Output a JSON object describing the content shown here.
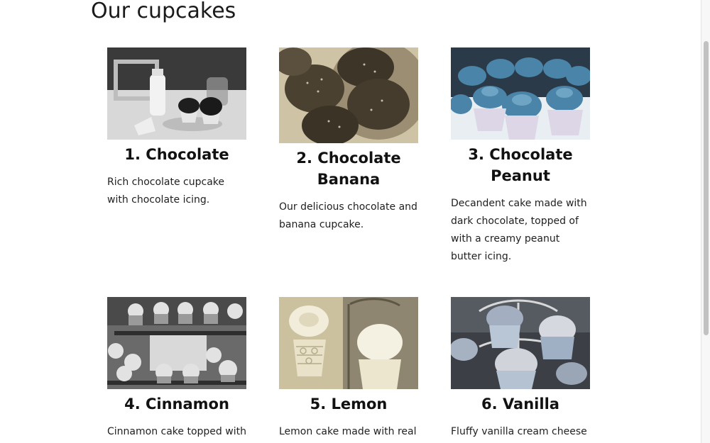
{
  "page": {
    "title": "Our cupcakes"
  },
  "cupcakes": [
    {
      "name": "1. Chocolate",
      "description": "Rich chocolate cupcake with chocolate icing.",
      "image_icon": "cupcake-with-milk-photo-icon"
    },
    {
      "name": "2. Chocolate Banana",
      "description": "Our delicious chocolate and banana cupcake.",
      "image_icon": "chocolate-truffle-cupcakes-photo-icon"
    },
    {
      "name": "3. Chocolate Peanut",
      "description": "Decandent cake made with dark chocolate, topped of with a creamy peanut butter icing.",
      "image_icon": "frosted-cupcakes-photo-icon"
    },
    {
      "name": "4. Cinnamon",
      "description": "Cinnamon cake topped with",
      "image_icon": "cupcake-tiered-stand-photo-icon"
    },
    {
      "name": "5. Lemon",
      "description": "Lemon cake made with real",
      "image_icon": "lace-cupcake-photo-icon"
    },
    {
      "name": "6. Vanilla",
      "description": "Fluffy vanilla cream cheese",
      "image_icon": "cupcake-metal-stand-photo-icon"
    }
  ],
  "colors": {
    "background": "#ffffff",
    "text": "#111111",
    "scrollbar_thumb": "#c2c2c2"
  }
}
